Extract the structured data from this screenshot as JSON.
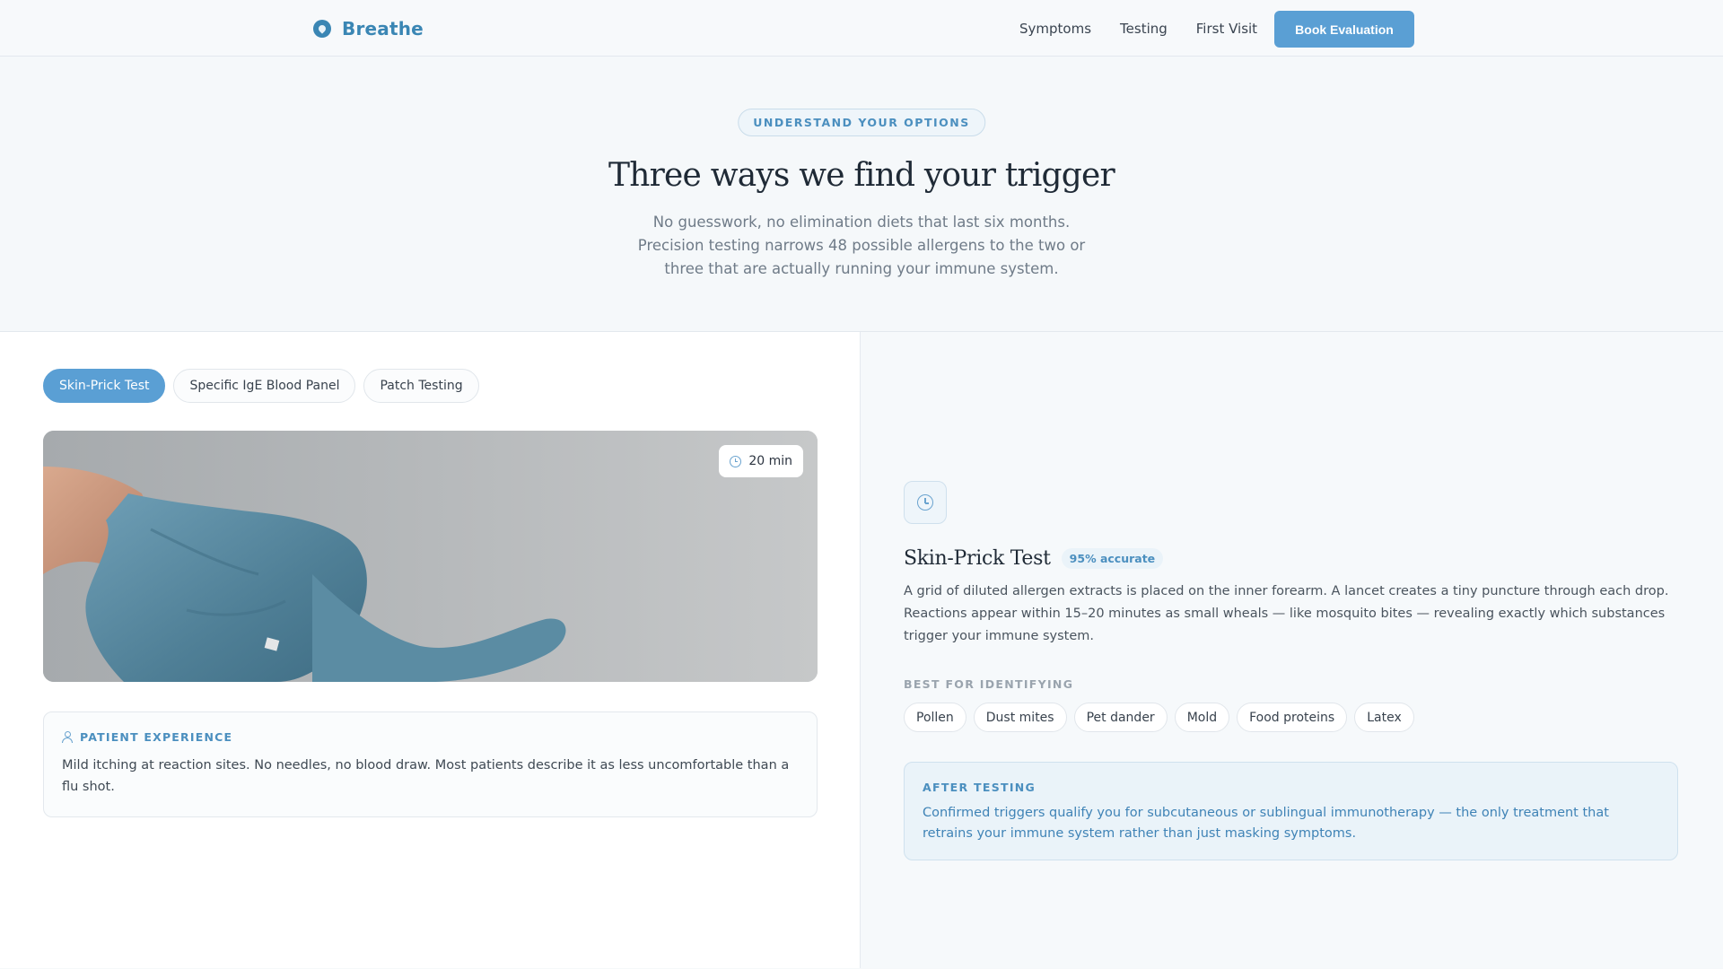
{
  "nav": {
    "brand": "Breathe",
    "links": [
      "Symptoms",
      "Testing",
      "First Visit"
    ],
    "cta": "Book Evaluation"
  },
  "hero": {
    "eyebrow": "UNDERSTAND YOUR OPTIONS",
    "title": "Three ways we find your trigger",
    "subtitle": "No guesswork, no elimination diets that last six months. Precision testing narrows 48 possible allergens to the two or three that are actually running your immune system."
  },
  "tabs": [
    {
      "label": "Skin-Prick Test",
      "active": true
    },
    {
      "label": "Specific IgE Blood Panel",
      "active": false
    },
    {
      "label": "Patch Testing",
      "active": false
    }
  ],
  "media": {
    "duration": "20 min"
  },
  "patient_experience": {
    "heading": "PATIENT EXPERIENCE",
    "text": "Mild itching at reaction sites. No needles, no blood draw. Most patients describe it as less uncomfortable than a flu shot."
  },
  "detail": {
    "title": "Skin-Prick Test",
    "accuracy": "95% accurate",
    "description": "A grid of diluted allergen extracts is placed on the inner forearm. A lancet creates a tiny puncture through each drop. Reactions appear within 15–20 minutes as small wheals — like mosquito bites — revealing exactly which substances trigger your immune system.",
    "best_for_label": "BEST FOR IDENTIFYING",
    "best_for": [
      "Pollen",
      "Dust mites",
      "Pet dander",
      "Mold",
      "Food proteins",
      "Latex"
    ],
    "after_heading": "AFTER TESTING",
    "after_text": "Confirmed triggers qualify you for subcutaneous or sublingual immunotherapy — the only treatment that retrains your immune system rather than just masking symptoms."
  },
  "colors": {
    "accent": "#5a9fd4",
    "brand": "#3a86b4",
    "glove": "#5f8fa6"
  }
}
